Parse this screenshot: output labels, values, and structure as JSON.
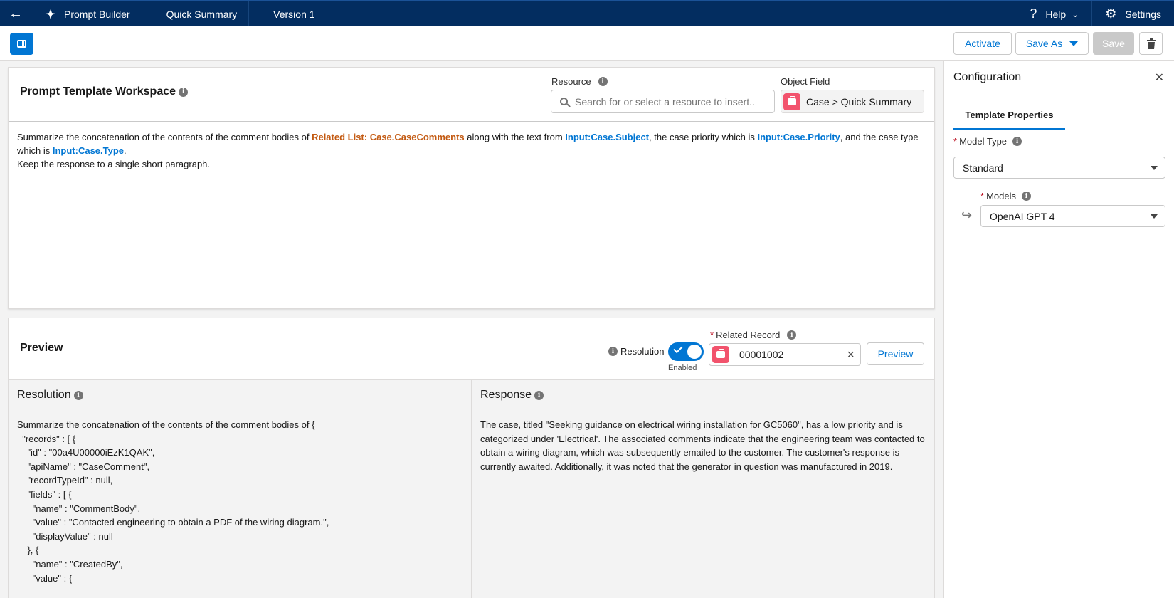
{
  "topbar": {
    "app_name": "Prompt Builder",
    "template_name": "Quick Summary",
    "version": "Version 1",
    "help_label": "Help",
    "settings_label": "Settings"
  },
  "toolbar": {
    "activate_label": "Activate",
    "save_as_label": "Save As",
    "save_label": "Save"
  },
  "workspace": {
    "title": "Prompt Template Workspace",
    "resource_label": "Resource",
    "resource_placeholder": "Search for or select a resource to insert..",
    "object_field_label": "Object Field",
    "object_field_value": "Case > Quick Summary",
    "prompt": {
      "t1": "Summarize the concatenation of the contents of the comment bodies of ",
      "tok1": "Related List: Case.CaseComments",
      "t2": " along with the text from ",
      "tok2": "Input:Case.Subject",
      "t3": ", the case priority which is ",
      "tok3": "Input:Case.Priority",
      "t4": ", and the case type which is ",
      "tok4": "Input:Case.Type",
      "t5": ".",
      "line2": "Keep the response to a single short paragraph."
    }
  },
  "preview": {
    "title": "Preview",
    "resolution_label": "Resolution",
    "toggle_state": "Enabled",
    "related_record_label": "Related Record",
    "related_record_value": "00001002",
    "preview_button": "Preview",
    "resolution_heading": "Resolution",
    "response_heading": "Response",
    "resolution_text": "Summarize the concatenation of the contents of the comment bodies of {\n  \"records\" : [ {\n    \"id\" : \"00a4U00000iEzK1QAK\",\n    \"apiName\" : \"CaseComment\",\n    \"recordTypeId\" : null,\n    \"fields\" : [ {\n      \"name\" : \"CommentBody\",\n      \"value\" : \"Contacted engineering to obtain a PDF of the wiring diagram.\",\n      \"displayValue\" : null\n    }, {\n      \"name\" : \"CreatedBy\",\n      \"value\" : {",
    "response_text": "The case, titled \"Seeking guidance on electrical wiring installation for GC5060\", has a low priority and is categorized under 'Electrical'. The associated comments indicate that the engineering team was contacted to obtain a wiring diagram, which was subsequently emailed to the customer. The customer's response is currently awaited. Additionally, it was noted that the generator in question was manufactured in 2019."
  },
  "config": {
    "title": "Configuration",
    "tab": "Template Properties",
    "model_type_label": "Model Type",
    "model_type_value": "Standard",
    "models_label": "Models",
    "models_value": "OpenAI GPT 4"
  },
  "icons": [
    "back-arrow-icon",
    "prompt-builder-logo-icon",
    "help-icon",
    "chevron-down-icon",
    "gear-icon",
    "panel-toggle-icon",
    "trash-icon",
    "info-icon",
    "search-icon",
    "case-icon",
    "close-icon",
    "checkmark-icon",
    "hook-arrow-icon"
  ],
  "colors": {
    "nav_bg": "#032d60",
    "brand_blue": "#0176d3",
    "token_orange": "#c35a12",
    "case_icon": "#f2536d"
  }
}
